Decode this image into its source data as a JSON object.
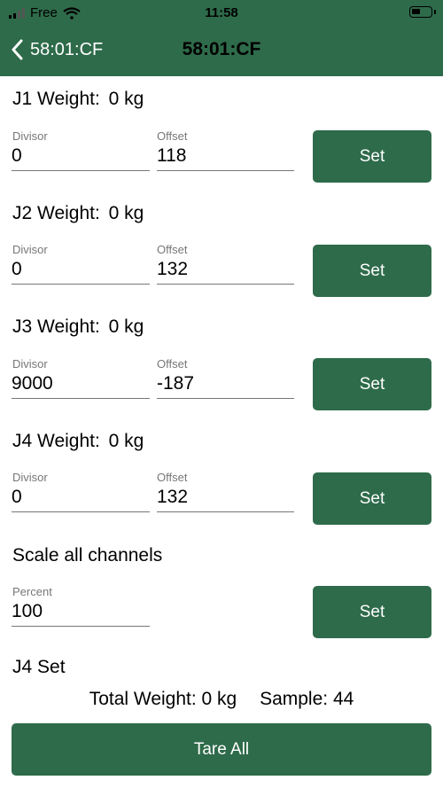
{
  "status_bar": {
    "carrier": "Free",
    "time": "11:58"
  },
  "nav": {
    "back_label": "58:01:CF",
    "title": "58:01:CF"
  },
  "channels": [
    {
      "title_label": "J1 Weight:",
      "weight": "0 kg",
      "divisor_label": "Divisor",
      "divisor": "0",
      "offset_label": "Offset",
      "offset": "118",
      "set_label": "Set"
    },
    {
      "title_label": "J2 Weight:",
      "weight": "0 kg",
      "divisor_label": "Divisor",
      "divisor": "0",
      "offset_label": "Offset",
      "offset": "132",
      "set_label": "Set"
    },
    {
      "title_label": "J3 Weight:",
      "weight": "0 kg",
      "divisor_label": "Divisor",
      "divisor": "9000",
      "offset_label": "Offset",
      "offset": "-187",
      "set_label": "Set"
    },
    {
      "title_label": "J4 Weight:",
      "weight": "0 kg",
      "divisor_label": "Divisor",
      "divisor": "0",
      "offset_label": "Offset",
      "offset": "132",
      "set_label": "Set"
    }
  ],
  "scale": {
    "title": "Scale all channels",
    "percent_label": "Percent",
    "percent": "100",
    "set_label": "Set"
  },
  "status_message": "J4 Set",
  "totals": {
    "total_weight": "Total Weight: 0 kg",
    "sample": "Sample: 44"
  },
  "tare_label": "Tare All",
  "colors": {
    "accent": "#2e6b4a"
  }
}
